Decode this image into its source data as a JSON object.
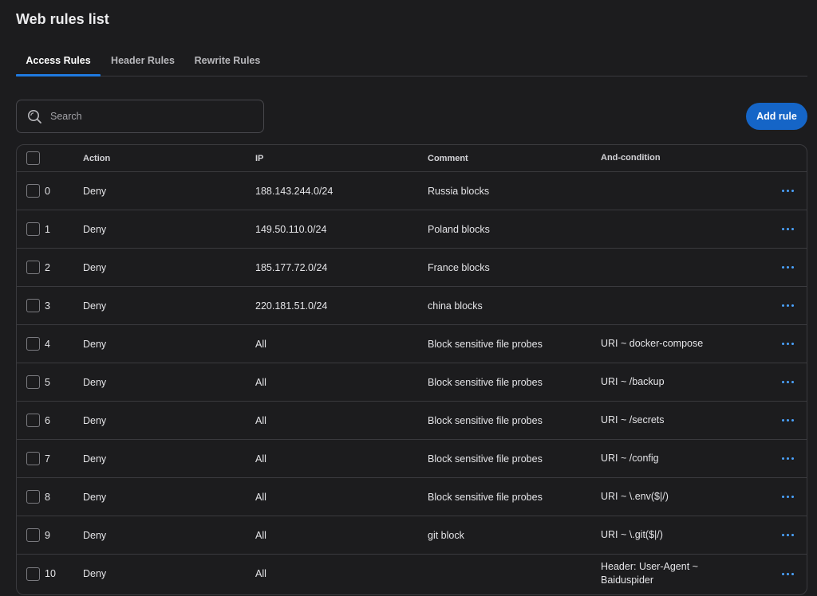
{
  "page": {
    "title": "Web rules list"
  },
  "tabs": [
    {
      "label": "Access Rules",
      "active": true
    },
    {
      "label": "Header Rules",
      "active": false
    },
    {
      "label": "Rewrite Rules",
      "active": false
    }
  ],
  "search": {
    "placeholder": "Search",
    "value": ""
  },
  "add_button": {
    "label": "Add rule"
  },
  "colors": {
    "accent": "#1f7ae0",
    "button": "#1565c7",
    "menu_dots": "#4aa3ff",
    "background": "#1c1c1e"
  },
  "table": {
    "columns": {
      "action": "Action",
      "ip": "IP",
      "comment": "Comment",
      "condition": "And-condition"
    },
    "rows": [
      {
        "num": "0",
        "action": "Deny",
        "ip": "188.143.244.0/24",
        "comment": "Russia blocks",
        "condition": ""
      },
      {
        "num": "1",
        "action": "Deny",
        "ip": "149.50.110.0/24",
        "comment": "Poland blocks",
        "condition": ""
      },
      {
        "num": "2",
        "action": "Deny",
        "ip": "185.177.72.0/24",
        "comment": "France blocks",
        "condition": ""
      },
      {
        "num": "3",
        "action": "Deny",
        "ip": "220.181.51.0/24",
        "comment": "china blocks",
        "condition": ""
      },
      {
        "num": "4",
        "action": "Deny",
        "ip": "All",
        "comment": "Block sensitive file probes",
        "condition": "URI ~ docker-compose"
      },
      {
        "num": "5",
        "action": "Deny",
        "ip": "All",
        "comment": "Block sensitive file probes",
        "condition": "URI ~ /backup"
      },
      {
        "num": "6",
        "action": "Deny",
        "ip": "All",
        "comment": "Block sensitive file probes",
        "condition": "URI ~ /secrets"
      },
      {
        "num": "7",
        "action": "Deny",
        "ip": "All",
        "comment": "Block sensitive file probes",
        "condition": "URI ~ /config"
      },
      {
        "num": "8",
        "action": "Deny",
        "ip": "All",
        "comment": "Block sensitive file probes",
        "condition": "URI ~ \\.env($|/)"
      },
      {
        "num": "9",
        "action": "Deny",
        "ip": "All",
        "comment": "git block",
        "condition": "URI ~ \\.git($|/)"
      },
      {
        "num": "10",
        "action": "Deny",
        "ip": "All",
        "comment": "",
        "condition": "Header: User-Agent ~ Baiduspider"
      }
    ]
  }
}
